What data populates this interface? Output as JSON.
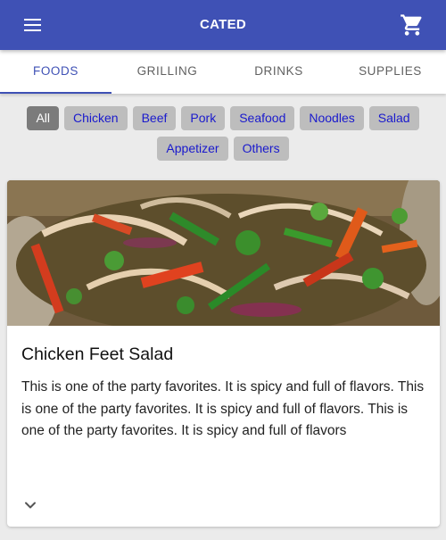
{
  "appbar": {
    "title": "CATED",
    "menu_icon": "menu-icon",
    "cart_icon": "shopping-cart-icon",
    "color": "#3f51b5"
  },
  "tabs": [
    {
      "label": "FOODS",
      "active": true
    },
    {
      "label": "GRILLING",
      "active": false
    },
    {
      "label": "DRINKS",
      "active": false
    },
    {
      "label": "SUPPLIES",
      "active": false
    }
  ],
  "categories": {
    "row1": [
      "All",
      "Chicken",
      "Beef",
      "Pork",
      "Seafood",
      "Noodles",
      "Salad"
    ],
    "row2": [
      "Appetizer",
      "Others"
    ],
    "selected": "All"
  },
  "card": {
    "title": "Chicken Feet Salad",
    "description": "This is one of the party favorites. It is spicy and full of flavors. This is one of the party favorites. It is spicy and full of flavors. This is one of the party favorites. It is spicy and full of flavors",
    "expand_icon": "chevron-down-icon"
  }
}
